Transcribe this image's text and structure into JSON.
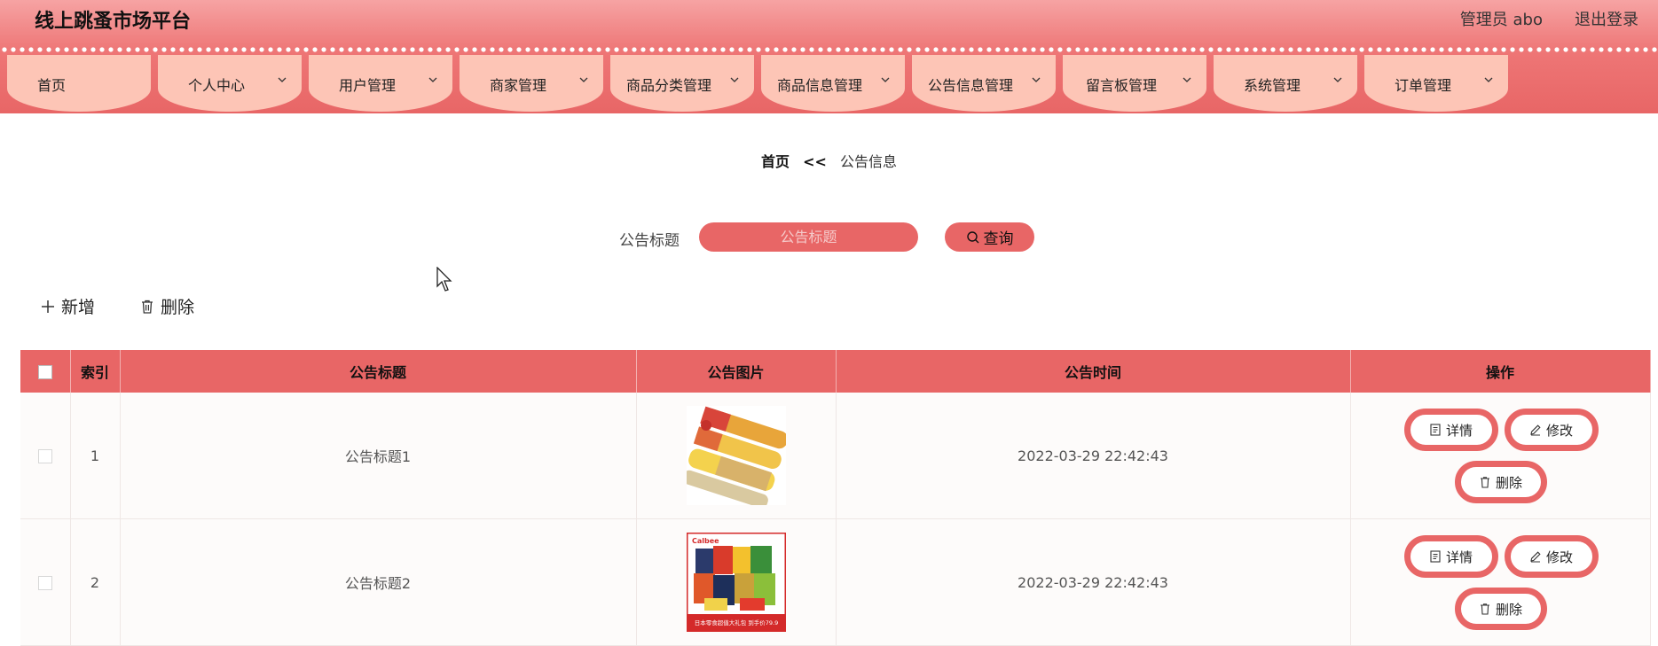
{
  "header": {
    "title": "线上跳蚤市场平台",
    "user_label": "管理员 abo",
    "logout_label": "退出登录"
  },
  "nav": {
    "items": [
      {
        "label": "首页",
        "has_dropdown": false
      },
      {
        "label": "个人中心",
        "has_dropdown": true
      },
      {
        "label": "用户管理",
        "has_dropdown": true
      },
      {
        "label": "商家管理",
        "has_dropdown": true
      },
      {
        "label": "商品分类管理",
        "has_dropdown": true
      },
      {
        "label": "商品信息管理",
        "has_dropdown": true
      },
      {
        "label": "公告信息管理",
        "has_dropdown": true
      },
      {
        "label": "留言板管理",
        "has_dropdown": true
      },
      {
        "label": "系统管理",
        "has_dropdown": true
      },
      {
        "label": "订单管理",
        "has_dropdown": true
      }
    ]
  },
  "breadcrumb": {
    "home": "首页",
    "separator": "<<",
    "current": "公告信息"
  },
  "search": {
    "label": "公告标题",
    "placeholder": "公告标题",
    "value": "",
    "button_label": "查询"
  },
  "toolbar": {
    "add_label": "新增",
    "delete_label": "删除"
  },
  "table": {
    "headers": {
      "index": "索引",
      "title": "公告标题",
      "image": "公告图片",
      "time": "公告时间",
      "actions": "操作"
    },
    "rows": [
      {
        "index": "1",
        "title": "公告标题1",
        "time": "2022-03-29 22:42:43",
        "image": "pringles-product-image"
      },
      {
        "index": "2",
        "title": "公告标题2",
        "time": "2022-03-29 22:42:43",
        "image": "snack-gift-box-image",
        "image_text": "日本零食超值大礼包 到手价79.9"
      }
    ],
    "action_labels": {
      "detail": "详情",
      "edit": "修改",
      "delete": "删除"
    }
  },
  "colors": {
    "primary": "#e86666",
    "nav_tab": "#fdc5b6",
    "header_light": "#f6a3a3"
  }
}
